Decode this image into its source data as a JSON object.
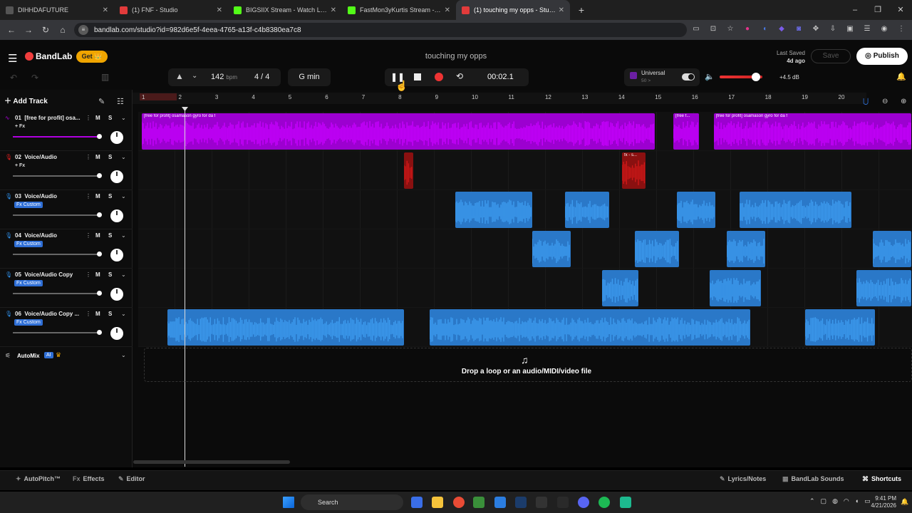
{
  "browser": {
    "tabs": [
      {
        "title": "DIHHDAFUTURE",
        "favicon_color": "#555555",
        "active": false
      },
      {
        "title": "(1) FNF - Studio",
        "favicon_color": "#e23b3b",
        "active": false
      },
      {
        "title": "BIGSIIX Stream - Watch Live on",
        "favicon_color": "#53fc18",
        "active": false
      },
      {
        "title": "FastMon3yKurtis Stream - Watc",
        "favicon_color": "#53fc18",
        "active": false
      },
      {
        "title": "(1) touching my opps - Studio",
        "favicon_color": "#e23b3b",
        "active": true
      }
    ],
    "new_tab": "+",
    "window_controls": [
      "–",
      "❐",
      "✕"
    ],
    "url": "bandlab.com/studio?id=982d6e5f-4eea-4765-a13f-c4b8380ea7c8"
  },
  "header": {
    "logo": "BandLab",
    "get_button": "Get 👑",
    "project_title": "touching my opps",
    "last_saved_label": "Last Saved",
    "last_saved_value": "4d ago",
    "save_button": "Save",
    "publish_button": "Publish"
  },
  "toolbar": {
    "bpm_value": "142",
    "bpm_unit": "bpm",
    "time_signature": "4 / 4",
    "key": "G min",
    "timer": "00:02.1",
    "master_preset": "Universal",
    "master_sub": "50 >",
    "volume_db": "+4.5 dB",
    "volume_level": 0.85
  },
  "tracks_panel": {
    "add_track": "Add Track",
    "tracks": [
      {
        "number": "01",
        "name": "[free for profit] osa...",
        "fx": "+ Fx",
        "fx_custom": false,
        "color": "#b000e0",
        "icon": "waveform-icon",
        "volume": 1.0
      },
      {
        "number": "02",
        "name": "Voice/Audio",
        "fx": "+ Fx",
        "fx_custom": false,
        "color": "#e02020",
        "icon": "mic-icon",
        "volume": 1.0
      },
      {
        "number": "03",
        "name": "Voice/Audio",
        "fx": "Fx Custom",
        "fx_custom": true,
        "color": "#2f8fe8",
        "icon": "mic-icon",
        "volume": 1.0
      },
      {
        "number": "04",
        "name": "Voice/Audio",
        "fx": "Fx Custom",
        "fx_custom": true,
        "color": "#2f8fe8",
        "icon": "mic-icon",
        "volume": 1.0
      },
      {
        "number": "05",
        "name": "Voice/Audio Copy",
        "fx": "Fx Custom",
        "fx_custom": true,
        "color": "#2f8fe8",
        "icon": "mic-icon",
        "volume": 1.0
      },
      {
        "number": "06",
        "name": "Voice/Audio Copy ...",
        "fx": "Fx Custom",
        "fx_custom": true,
        "color": "#2f8fe8",
        "icon": "mic-icon",
        "volume": 1.0
      }
    ],
    "mute_label": "M",
    "solo_label": "S",
    "automix_label": "AutoMix",
    "ai_badge": "AI"
  },
  "timeline": {
    "bars": [
      "1",
      "2",
      "3",
      "4",
      "5",
      "6",
      "7",
      "8",
      "9",
      "10",
      "11",
      "12",
      "13",
      "14",
      "15",
      "16",
      "17",
      "18",
      "19",
      "20"
    ],
    "regions": [
      {
        "track": 0,
        "start": 1,
        "end": 15,
        "label": "[free for profit] osamason gyro for da f"
      },
      {
        "track": 0,
        "start": 15.5,
        "end": 16.2,
        "label": "[free f..."
      },
      {
        "track": 0,
        "start": 16.6,
        "end": 22,
        "label": "[free for profit] osamason gyro for da f"
      },
      {
        "track": 1,
        "start": 8.15,
        "end": 8.4,
        "label": ""
      },
      {
        "track": 1,
        "start": 14.1,
        "end": 14.75,
        "label": "fx - s..."
      },
      {
        "track": 2,
        "start": 9.55,
        "end": 11.65,
        "label": ""
      },
      {
        "track": 2,
        "start": 12.55,
        "end": 13.75,
        "label": ""
      },
      {
        "track": 2,
        "start": 15.6,
        "end": 16.65,
        "label": ""
      },
      {
        "track": 2,
        "start": 17.3,
        "end": 20.35,
        "label": ""
      },
      {
        "track": 3,
        "start": 11.65,
        "end": 12.7,
        "label": ""
      },
      {
        "track": 3,
        "start": 14.45,
        "end": 15.65,
        "label": ""
      },
      {
        "track": 3,
        "start": 16.95,
        "end": 18.0,
        "label": ""
      },
      {
        "track": 3,
        "start": 20.95,
        "end": 22,
        "label": ""
      },
      {
        "track": 4,
        "start": 13.55,
        "end": 14.55,
        "label": ""
      },
      {
        "track": 4,
        "start": 16.5,
        "end": 17.9,
        "label": ""
      },
      {
        "track": 4,
        "start": 20.5,
        "end": 22,
        "label": ""
      },
      {
        "track": 5,
        "start": 1.7,
        "end": 8.15,
        "label": ""
      },
      {
        "track": 5,
        "start": 8.85,
        "end": 17.6,
        "label": ""
      },
      {
        "track": 5,
        "start": 19.1,
        "end": 21.0,
        "label": ""
      }
    ],
    "drop_text": "Drop a loop or an audio/MIDI/video file"
  },
  "bottom_bar": {
    "autopitch": "AutoPitch™",
    "effects": "Effects",
    "editor": "Editor",
    "lyrics": "Lyrics/Notes",
    "sounds": "BandLab Sounds",
    "shortcuts": "Shortcuts"
  },
  "taskbar": {
    "search": "Search",
    "time": "9:41 PM",
    "date": "4/21/2026"
  }
}
